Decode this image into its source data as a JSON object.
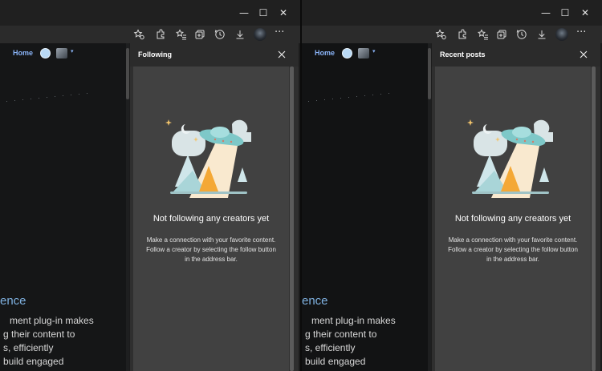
{
  "window_controls": {
    "minimize": "—",
    "maximize": "☐",
    "close": "✕"
  },
  "toolbar_more": "···",
  "page_nav": {
    "home": "Home",
    "caret": "▾"
  },
  "page_text": {
    "heading": "ence",
    "lines": [
      "ment plug-in makes",
      "g their content to",
      "s, efficiently",
      "build engaged"
    ]
  },
  "left_panel": {
    "title": "Following",
    "empty_title": "Not following any creators yet",
    "empty_lines": [
      "Make a connection with your favorite content.",
      "Follow a creator by selecting the follow button",
      "in the address bar."
    ]
  },
  "right_panel": {
    "title": "Recent posts",
    "empty_title": "Not following any creators yet",
    "empty_lines": [
      "Make a connection with your favorite content.",
      "Follow a creator by selecting the follow button",
      "in the address bar."
    ]
  },
  "icons": [
    "favorites-star-icon",
    "extensions-icon",
    "favorites-bar-icon",
    "collections-icon",
    "history-icon",
    "downloads-icon",
    "profile-avatar"
  ],
  "colors": {
    "accent_link": "#8ab4f8",
    "panel_bg": "#414141",
    "heading_blue": "#7fb1e0"
  }
}
